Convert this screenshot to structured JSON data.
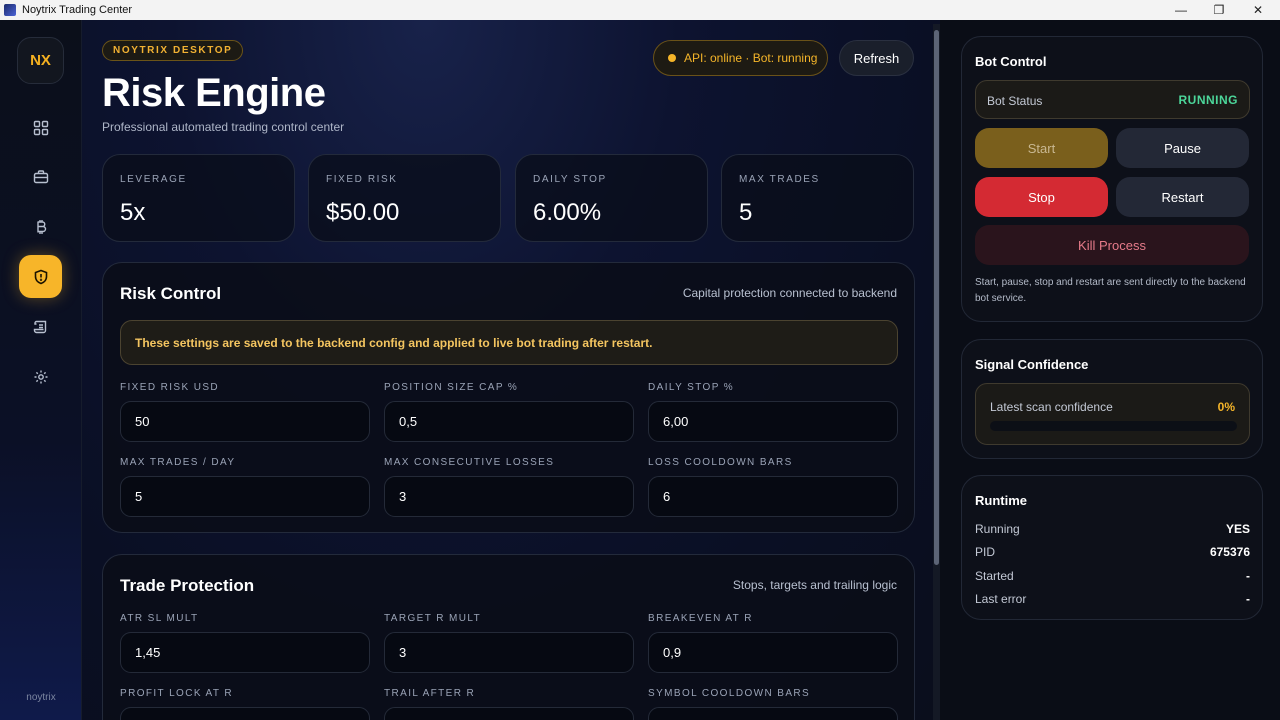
{
  "window": {
    "title": "Noytrix Trading Center",
    "minimize": "—",
    "maximize": "❐",
    "close": "✕"
  },
  "sidebar": {
    "logo": "NX",
    "items": [
      {
        "name": "dashboard",
        "icon": "grid-icon",
        "active": false
      },
      {
        "name": "portfolio",
        "icon": "briefcase-icon",
        "active": false
      },
      {
        "name": "strategy",
        "icon": "bitcoin-icon",
        "active": false
      },
      {
        "name": "risk",
        "icon": "shield-icon",
        "active": true
      },
      {
        "name": "logs",
        "icon": "scroll-icon",
        "active": false
      },
      {
        "name": "settings",
        "icon": "gear-icon",
        "active": false
      }
    ],
    "footer": "noytrix"
  },
  "header": {
    "badge": "NOYTRIX DESKTOP",
    "title": "Risk Engine",
    "subtitle": "Professional automated trading control center",
    "api_status": "API: online · Bot: running",
    "refresh_label": "Refresh"
  },
  "stats": [
    {
      "label": "LEVERAGE",
      "value": "5x"
    },
    {
      "label": "FIXED RISK",
      "value": "$50.00"
    },
    {
      "label": "DAILY STOP",
      "value": "6.00%"
    },
    {
      "label": "MAX TRADES",
      "value": "5"
    }
  ],
  "risk_control": {
    "title": "Risk Control",
    "hint": "Capital protection connected to backend",
    "notice": "These settings are saved to the backend config and applied to live bot trading after restart.",
    "fields": [
      {
        "label": "FIXED RISK USD",
        "value": "50"
      },
      {
        "label": "POSITION SIZE CAP %",
        "value": "0,5"
      },
      {
        "label": "DAILY STOP %",
        "value": "6,00"
      },
      {
        "label": "MAX TRADES / DAY",
        "value": "5"
      },
      {
        "label": "MAX CONSECUTIVE LOSSES",
        "value": "3"
      },
      {
        "label": "LOSS COOLDOWN BARS",
        "value": "6"
      }
    ]
  },
  "trade_protection": {
    "title": "Trade Protection",
    "hint": "Stops, targets and trailing logic",
    "fields": [
      {
        "label": "ATR SL MULT",
        "value": "1,45"
      },
      {
        "label": "TARGET R MULT",
        "value": "3"
      },
      {
        "label": "BREAKEVEN AT R",
        "value": "0,9"
      },
      {
        "label": "PROFIT LOCK AT R",
        "value": ""
      },
      {
        "label": "TRAIL AFTER R",
        "value": ""
      },
      {
        "label": "SYMBOL COOLDOWN BARS",
        "value": ""
      }
    ]
  },
  "bot_control": {
    "title": "Bot Control",
    "status_label": "Bot Status",
    "status_value": "RUNNING",
    "start": "Start",
    "pause": "Pause",
    "stop": "Stop",
    "restart": "Restart",
    "kill": "Kill Process",
    "note": "Start, pause, stop and restart are sent directly to the backend bot service."
  },
  "signal": {
    "title": "Signal Confidence",
    "label": "Latest scan confidence",
    "value": "0%",
    "fraction": 0
  },
  "runtime": {
    "title": "Runtime",
    "rows": [
      {
        "label": "Running",
        "value": "YES"
      },
      {
        "label": "PID",
        "value": "675376"
      },
      {
        "label": "Started",
        "value": "-"
      },
      {
        "label": "Last error",
        "value": "-"
      }
    ]
  }
}
